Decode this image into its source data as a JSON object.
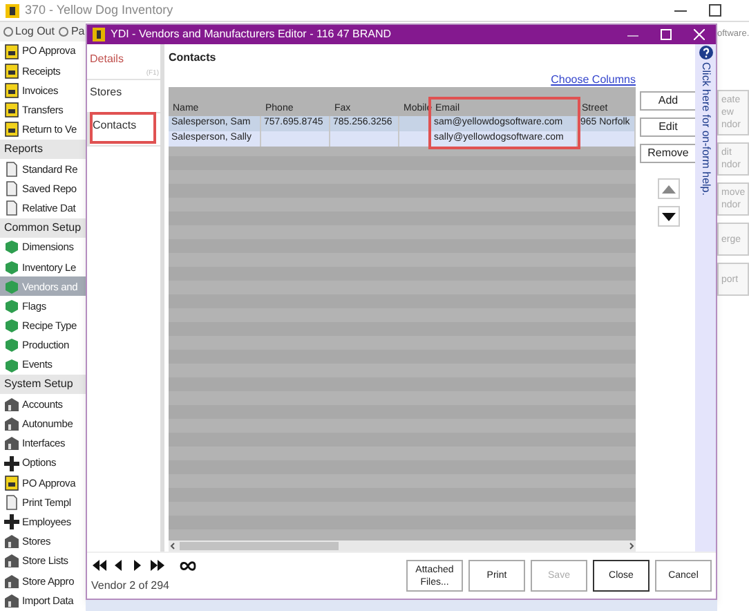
{
  "app_window": {
    "title": "370 - Yellow Dog Inventory",
    "toolbar": [
      "Log Out",
      "Pa"
    ],
    "sidebar": [
      {
        "kind": "item",
        "label": "PO Approva",
        "selected": false
      },
      {
        "kind": "item",
        "label": "Receipts",
        "selected": false
      },
      {
        "kind": "item",
        "label": "Invoices",
        "selected": false
      },
      {
        "kind": "item",
        "label": "Transfers",
        "selected": false
      },
      {
        "kind": "item",
        "label": "Return to Ve",
        "selected": false
      },
      {
        "kind": "section",
        "label": "Reports"
      },
      {
        "kind": "item",
        "label": "Standard Re",
        "selected": false
      },
      {
        "kind": "item",
        "label": "Saved Repo",
        "selected": false
      },
      {
        "kind": "item",
        "label": "Relative Dat",
        "selected": false
      },
      {
        "kind": "section",
        "label": "Common Setup"
      },
      {
        "kind": "item",
        "label": "Dimensions",
        "selected": false
      },
      {
        "kind": "item",
        "label": "Inventory Le",
        "selected": false
      },
      {
        "kind": "item",
        "label": "Vendors and",
        "selected": true
      },
      {
        "kind": "item",
        "label": "Flags",
        "selected": false
      },
      {
        "kind": "item",
        "label": "Recipe Type",
        "selected": false
      },
      {
        "kind": "item",
        "label": "Production",
        "selected": false
      },
      {
        "kind": "item",
        "label": "Events",
        "selected": false
      },
      {
        "kind": "section",
        "label": "System Setup"
      },
      {
        "kind": "item",
        "label": "Accounts",
        "selected": false
      },
      {
        "kind": "item",
        "label": "Autonumbe",
        "selected": false
      },
      {
        "kind": "item",
        "label": "Interfaces",
        "selected": false
      },
      {
        "kind": "item",
        "label": "Options",
        "selected": false
      },
      {
        "kind": "item",
        "label": "PO Approva",
        "selected": false
      },
      {
        "kind": "item",
        "label": "Print Templ",
        "selected": false
      },
      {
        "kind": "item",
        "label": "Employees",
        "selected": false
      },
      {
        "kind": "item",
        "label": "Stores",
        "selected": false
      },
      {
        "kind": "item",
        "label": "Store Lists",
        "selected": false
      },
      {
        "kind": "item",
        "label": "Store Appro",
        "selected": false
      },
      {
        "kind": "item",
        "label": "Import Data",
        "selected": false
      }
    ],
    "right_panel": {
      "url": "oftware.",
      "buttons": [
        "eate\new\nndor",
        "dit\nndor",
        "move\nndor",
        "erge",
        "port"
      ]
    }
  },
  "editor": {
    "title": "YDI - Vendors and Manufacturers Editor - 116 47 BRAND",
    "nav": [
      {
        "label": "Details",
        "hint": "(F1)",
        "color": "#c0504d",
        "selected": false
      },
      {
        "label": "Stores",
        "color": "#333333",
        "selected": false
      },
      {
        "label": "Contacts",
        "color": "#333333",
        "selected": true
      }
    ],
    "section_title": "Contacts",
    "choose_columns": "Choose Columns",
    "table": {
      "columns": [
        "Name",
        "Phone",
        "Fax",
        "Mobile",
        "Email",
        "Street"
      ],
      "rows": [
        {
          "cells": [
            "Salesperson, Sam",
            "757.695.8745",
            "785.256.3256",
            "",
            "sam@yellowdogsoftware.com",
            "965 Norfolk"
          ],
          "selected": true
        },
        {
          "cells": [
            "Salesperson, Sally",
            "",
            "",
            "",
            "sally@yellowdogsoftware.com",
            ""
          ],
          "selected": false
        }
      ]
    },
    "side_buttons": [
      "Add",
      "Edit",
      "Remove"
    ],
    "help_text": "Click here for on-form help.",
    "record_label": "Vendor 2 of 294",
    "buttons": [
      {
        "label": "Attached Files...",
        "disabled": false,
        "default": false
      },
      {
        "label": "Print",
        "disabled": false,
        "default": false
      },
      {
        "label": "Save",
        "disabled": true,
        "default": false
      },
      {
        "label": "Close",
        "disabled": false,
        "default": true
      },
      {
        "label": "Cancel",
        "disabled": false,
        "default": false
      }
    ]
  }
}
